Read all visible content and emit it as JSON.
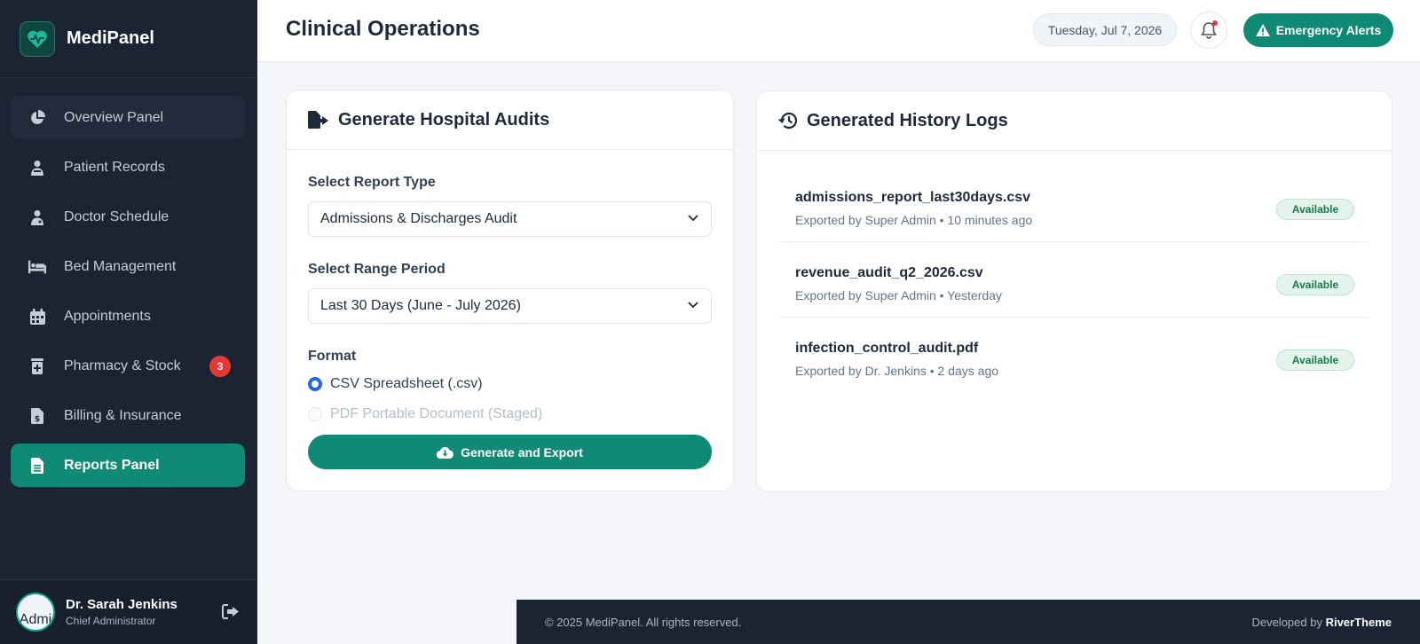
{
  "brand": {
    "name": "MediPanel"
  },
  "sidebar": {
    "items": [
      {
        "label": "Overview Panel",
        "icon": "pie-chart-icon"
      },
      {
        "label": "Patient Records",
        "icon": "user-injured-icon"
      },
      {
        "label": "Doctor Schedule",
        "icon": "user-doctor-icon"
      },
      {
        "label": "Bed Management",
        "icon": "bed-icon"
      },
      {
        "label": "Appointments",
        "icon": "calendar-icon"
      },
      {
        "label": "Pharmacy & Stock",
        "icon": "medkit-icon",
        "badge": "3"
      },
      {
        "label": "Billing & Insurance",
        "icon": "invoice-icon"
      },
      {
        "label": "Reports Panel",
        "icon": "file-icon",
        "active": true
      }
    ],
    "user": {
      "avatar_text": "Admi",
      "name": "Dr. Sarah Jenkins",
      "role": "Chief Administrator"
    }
  },
  "header": {
    "title": "Clinical Operations",
    "date": "Tuesday, Jul 7, 2026",
    "alert_label": "Emergency Alerts"
  },
  "audit": {
    "title": "Generate Hospital Audits",
    "report_type_label": "Select Report Type",
    "report_type_value": "Admissions & Discharges Audit",
    "range_label": "Select Range Period",
    "range_value": "Last 30 Days (June - July 2026)",
    "format_label": "Format",
    "format_options": [
      {
        "label": "CSV Spreadsheet (.csv)",
        "selected": true,
        "disabled": false
      },
      {
        "label": "PDF Portable Document (Staged)",
        "selected": false,
        "disabled": true
      }
    ],
    "generate_label": "Generate and Export"
  },
  "history": {
    "title": "Generated History Logs",
    "logs": [
      {
        "name": "admissions_report_last30days.csv",
        "meta": "Exported by Super Admin • 10 minutes ago",
        "status": "Available"
      },
      {
        "name": "revenue_audit_q2_2026.csv",
        "meta": "Exported by Super Admin • Yesterday",
        "status": "Available"
      },
      {
        "name": "infection_control_audit.pdf",
        "meta": "Exported by Dr. Jenkins • 2 days ago",
        "status": "Available"
      }
    ]
  },
  "footer": {
    "copyright": "© 2025 MediPanel. All rights reserved.",
    "developed_prefix": "Developed by",
    "developer": "RiverTheme"
  },
  "colors": {
    "accent": "#0e8a75",
    "sidebar_bg": "#1b2433",
    "badge": "#e53935",
    "radio": "#2563eb"
  }
}
